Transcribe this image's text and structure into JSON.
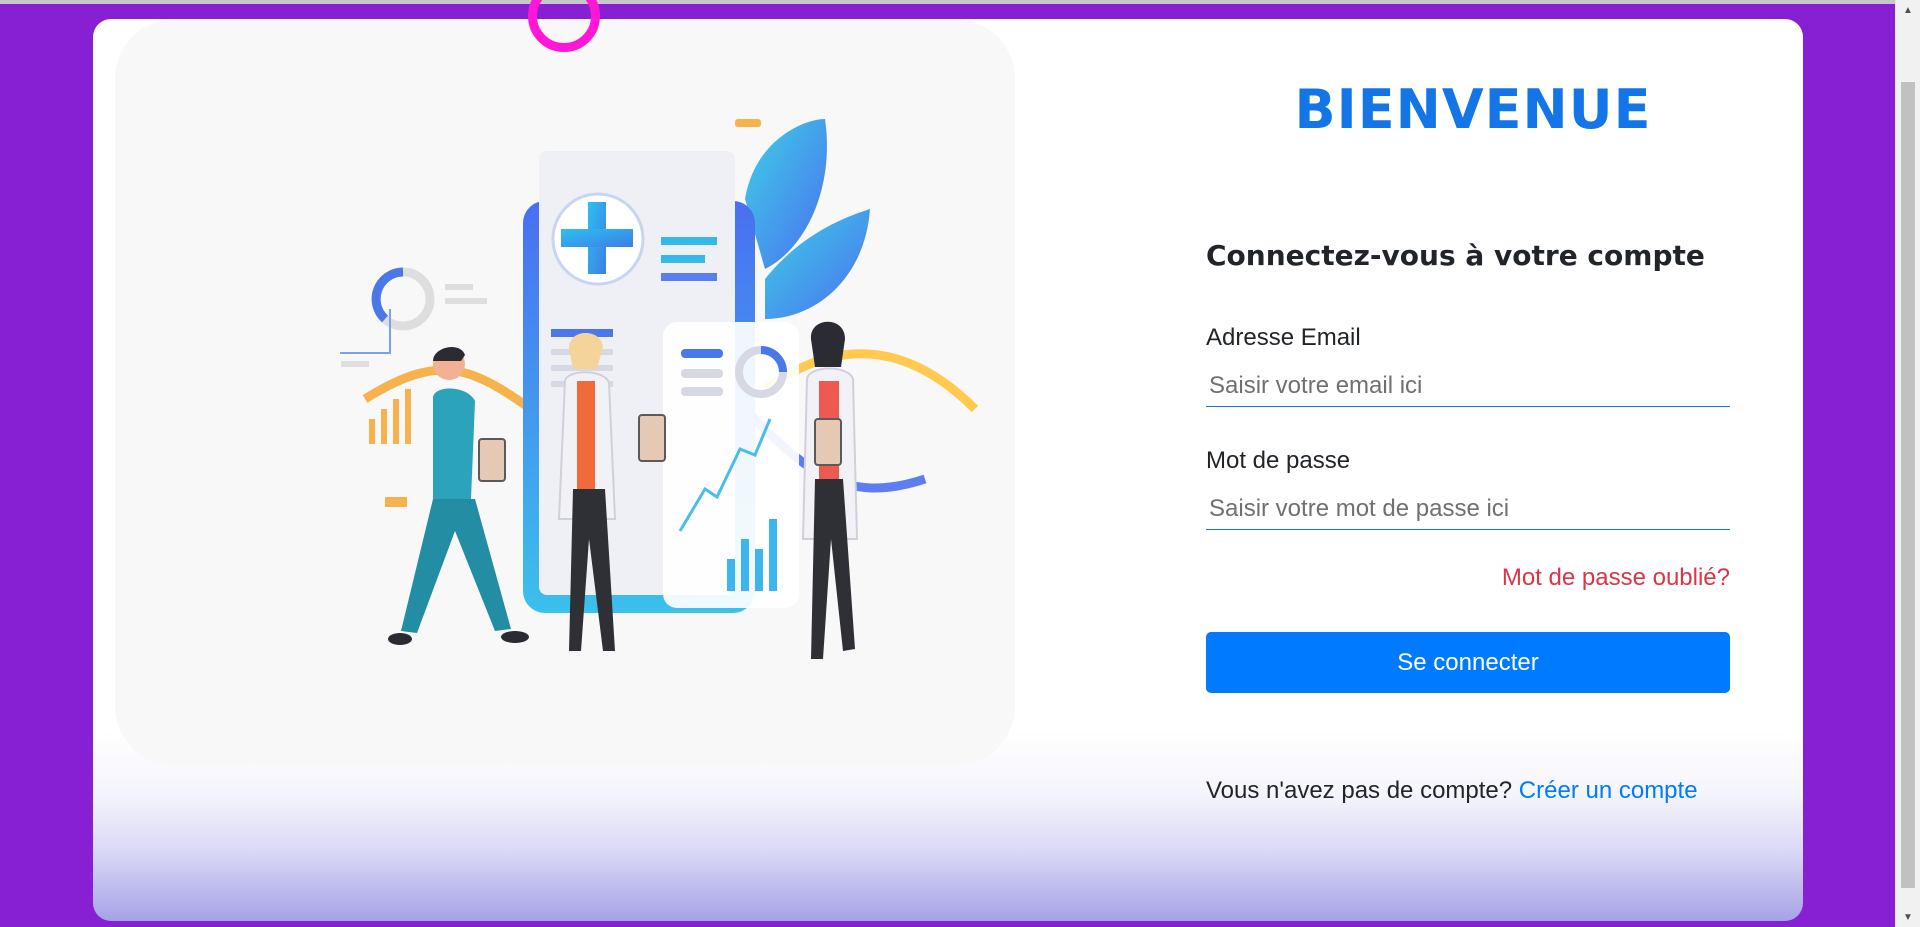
{
  "header": {
    "welcome": "BIENVENUE"
  },
  "form": {
    "title": "Connectez-vous à votre compte",
    "email_label": "Adresse Email",
    "email_placeholder": "Saisir votre email ici",
    "email_value": "",
    "password_label": "Mot de passe",
    "password_placeholder": "Saisir votre mot de passe ici",
    "password_value": "",
    "forgot_link": "Mot de passe oublié?",
    "submit_label": "Se connecter",
    "signup_prompt": "Vous n'avez pas de compte?",
    "signup_link": "Créer un compte"
  },
  "colors": {
    "background": "#8720d3",
    "brand": "#1476e6",
    "primary_button": "#007bff",
    "danger_link": "#dc3545",
    "decoration_ring": "#ff17d8"
  },
  "icons": {
    "illustration": "medical-team-illustration",
    "decoration": "ring-icon"
  }
}
